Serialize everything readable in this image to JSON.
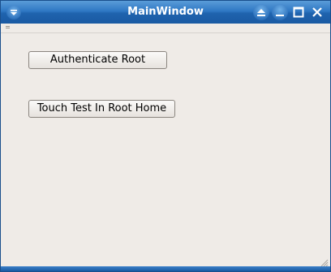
{
  "window": {
    "title": "MainWindow"
  },
  "icons": {
    "menu": "window-menu-icon",
    "shade": "shade-icon",
    "minimize": "minimize-icon",
    "maximize": "maximize-icon",
    "close": "close-icon"
  },
  "colors": {
    "titlebar": "#2f78c4",
    "background": "#efebe7",
    "border": "#1a4f8c"
  },
  "buttons": {
    "authenticate_label": "Authenticate Root",
    "touch_label": "Touch Test In Root Home"
  }
}
